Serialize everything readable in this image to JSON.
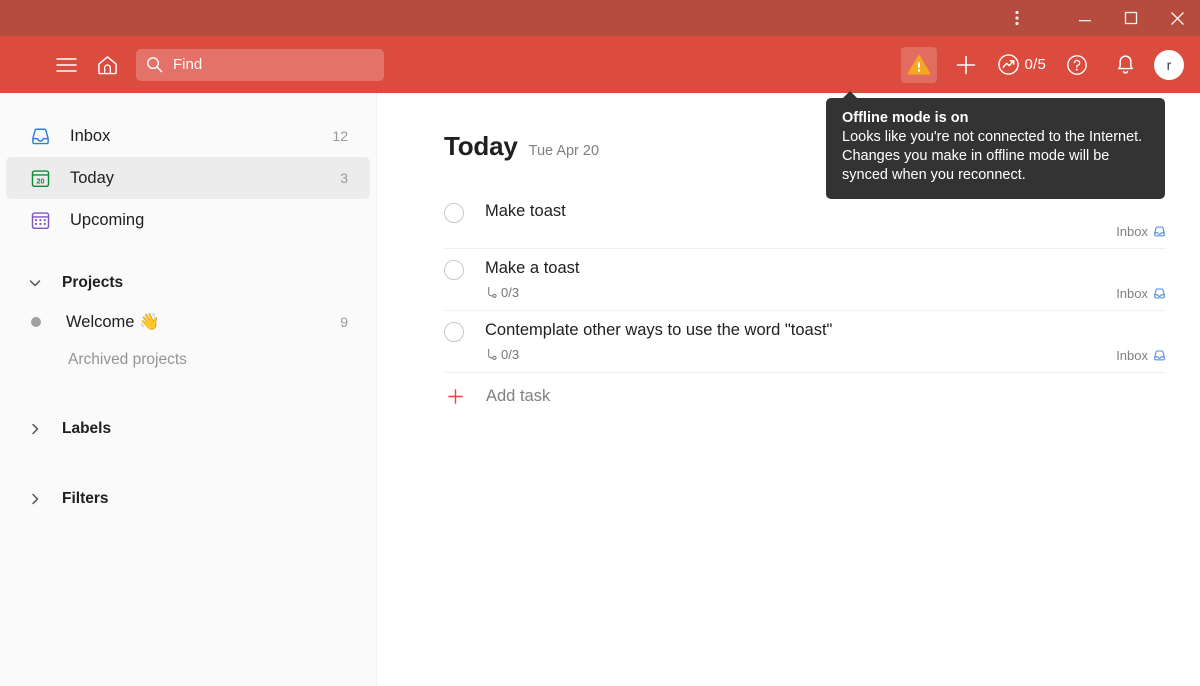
{
  "window": {
    "menu_icon": "kebab-menu-icon",
    "minimize_label": "Minimize",
    "maximize_label": "Maximize",
    "close_label": "Close"
  },
  "toolbar": {
    "menu_icon": "hamburger-menu-icon",
    "home_icon": "home-icon",
    "search": {
      "placeholder": "Find",
      "icon": "search-icon"
    },
    "offline_icon": "warning-triangle-icon",
    "add_icon": "plus-icon",
    "karma": {
      "icon": "productivity-chart-icon",
      "value": "0/5"
    },
    "help_icon": "question-mark-icon",
    "notifications_icon": "bell-icon",
    "avatar": {
      "initial": "r",
      "name": "user-avatar"
    }
  },
  "tooltip": {
    "title": "Offline mode is on",
    "body": "Looks like you're not connected to the Internet. Changes you make in offline mode will be synced when you reconnect."
  },
  "sidebar": {
    "nav": [
      {
        "label": "Inbox",
        "count": "12",
        "icon": "inbox-icon",
        "active": false
      },
      {
        "label": "Today",
        "count": "3",
        "icon": "today-calendar-icon",
        "active": true
      },
      {
        "label": "Upcoming",
        "count": "",
        "icon": "upcoming-calendar-icon",
        "active": false
      }
    ],
    "projects": {
      "title": "Projects",
      "chevron": "chevron-down-icon",
      "items": [
        {
          "label": "Welcome 👋",
          "count": "9",
          "dot_color": "#a0a0a0"
        }
      ],
      "archived_label": "Archived projects"
    },
    "labels": {
      "title": "Labels",
      "chevron": "chevron-right-icon"
    },
    "filters": {
      "title": "Filters",
      "chevron": "chevron-right-icon"
    }
  },
  "main": {
    "title": "Today",
    "date": "Tue Apr 20",
    "tasks": [
      {
        "title": "Make toast",
        "subtasks": "",
        "project": "Inbox"
      },
      {
        "title": "Make a toast",
        "subtasks": "0/3",
        "project": "Inbox"
      },
      {
        "title": "Contemplate other ways to use the word \"toast\"",
        "subtasks": "0/3",
        "project": "Inbox"
      }
    ],
    "add_task_label": "Add task"
  },
  "colors": {
    "titlebar": "#b54c3d",
    "toolbar": "#dc4c3e",
    "accent": "#dc4c3e",
    "sidebar_bg": "#fafafa",
    "warning": "#f5a623",
    "tooltip_bg": "#333333"
  }
}
